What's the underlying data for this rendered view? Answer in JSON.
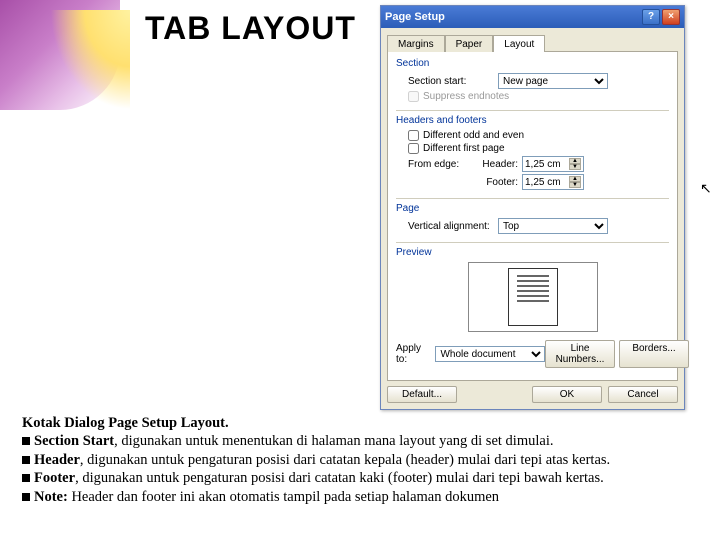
{
  "slide": {
    "title": "TAB LAYOUT"
  },
  "body": {
    "heading": "Kotak Dialog Page Setup Layout.",
    "items": [
      {
        "label": "Section Start",
        "text": ", digunakan untuk menentukan di halaman mana layout yang di set dimulai."
      },
      {
        "label": "Header",
        "text": ", digunakan untuk pengaturan posisi dari catatan kepala (header) mulai dari tepi atas kertas."
      },
      {
        "label": "Footer",
        "text": ", digunakan untuk pengaturan posisi dari catatan kaki (footer) mulai dari tepi bawah kertas."
      },
      {
        "label": "Note:",
        "text": " Header dan footer ini akan otomatis tampil pada setiap  halaman dokumen"
      }
    ]
  },
  "dialog": {
    "title": "Page Setup",
    "tabs": {
      "margins": "Margins",
      "paper": "Paper",
      "layout": "Layout"
    },
    "section": {
      "group": "Section",
      "start_label": "Section start:",
      "start_value": "New page",
      "suppress": "Suppress endnotes"
    },
    "headers": {
      "group": "Headers and footers",
      "diff_oe": "Different odd and even",
      "diff_fp": "Different first page",
      "from_edge": "From edge:",
      "header_label": "Header:",
      "header_value": "1,25 cm",
      "footer_label": "Footer:",
      "footer_value": "1,25 cm"
    },
    "page": {
      "group": "Page",
      "valign_label": "Vertical alignment:",
      "valign_value": "Top"
    },
    "preview": {
      "group": "Preview"
    },
    "apply": {
      "label": "Apply to:",
      "value": "Whole document"
    },
    "buttons": {
      "line_numbers": "Line Numbers...",
      "borders": "Borders...",
      "default": "Default...",
      "ok": "OK",
      "cancel": "Cancel"
    }
  }
}
